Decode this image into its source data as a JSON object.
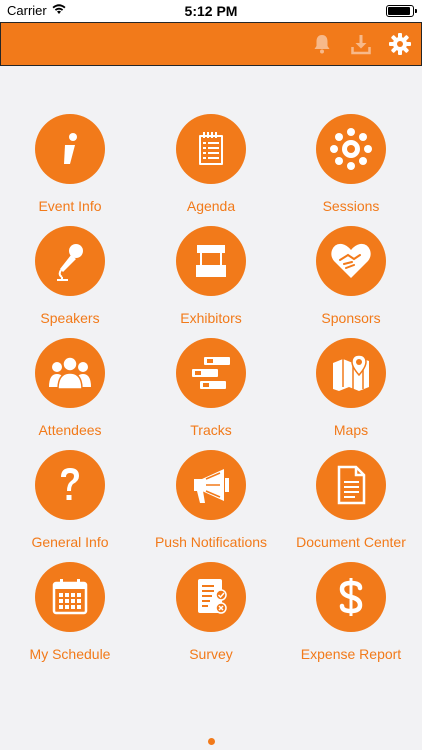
{
  "status_bar": {
    "carrier": "Carrier",
    "time": "5:12 PM"
  },
  "app_bar": {
    "background_color": "#f27a1a",
    "buttons": [
      {
        "icon": "bell-icon"
      },
      {
        "icon": "download-icon"
      },
      {
        "icon": "gear-icon"
      }
    ]
  },
  "menu": {
    "accent_color": "#f27a1a",
    "items": [
      {
        "label": "Event Info",
        "icon": "info-icon"
      },
      {
        "label": "Agenda",
        "icon": "agenda-icon"
      },
      {
        "label": "Sessions",
        "icon": "sessions-icon"
      },
      {
        "label": "Speakers",
        "icon": "microphone-icon"
      },
      {
        "label": "Exhibitors",
        "icon": "booth-icon"
      },
      {
        "label": "Sponsors",
        "icon": "handshake-heart-icon"
      },
      {
        "label": "Attendees",
        "icon": "people-icon"
      },
      {
        "label": "Tracks",
        "icon": "tracks-icon"
      },
      {
        "label": "Maps",
        "icon": "map-icon"
      },
      {
        "label": "General Info",
        "icon": "question-icon"
      },
      {
        "label": "Push Notifications",
        "icon": "megaphone-icon"
      },
      {
        "label": "Document Center",
        "icon": "document-icon"
      },
      {
        "label": "My Schedule",
        "icon": "calendar-icon"
      },
      {
        "label": "Survey",
        "icon": "survey-icon"
      },
      {
        "label": "Expense Report",
        "icon": "dollar-icon"
      }
    ]
  },
  "pager": {
    "current_page": 1
  }
}
